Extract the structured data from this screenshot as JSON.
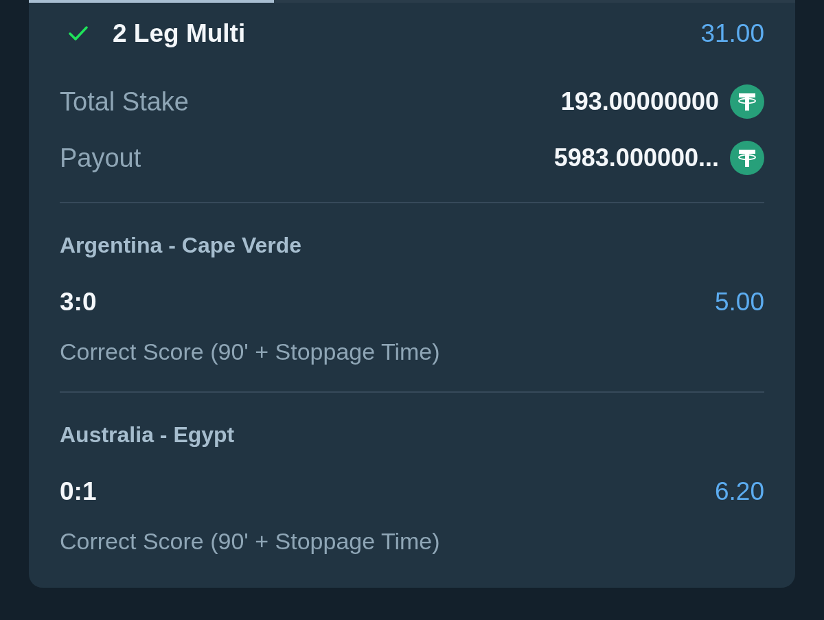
{
  "progress": {
    "level": 0.32
  },
  "bet": {
    "won": true,
    "title": "2 Leg Multi",
    "odds": "31.00"
  },
  "summary": [
    {
      "label": "Total Stake",
      "amount": "193.00000000"
    },
    {
      "label": "Payout",
      "amount": "5983.000000..."
    }
  ],
  "legs": [
    {
      "match": "Argentina - Cape Verde",
      "selection": "3:0",
      "odds": "5.00",
      "market": "Correct Score (90' + Stoppage Time)"
    },
    {
      "match": "Australia - Egypt",
      "selection": "0:1",
      "odds": "6.20",
      "market": "Correct Score (90' + Stoppage Time)"
    }
  ]
}
